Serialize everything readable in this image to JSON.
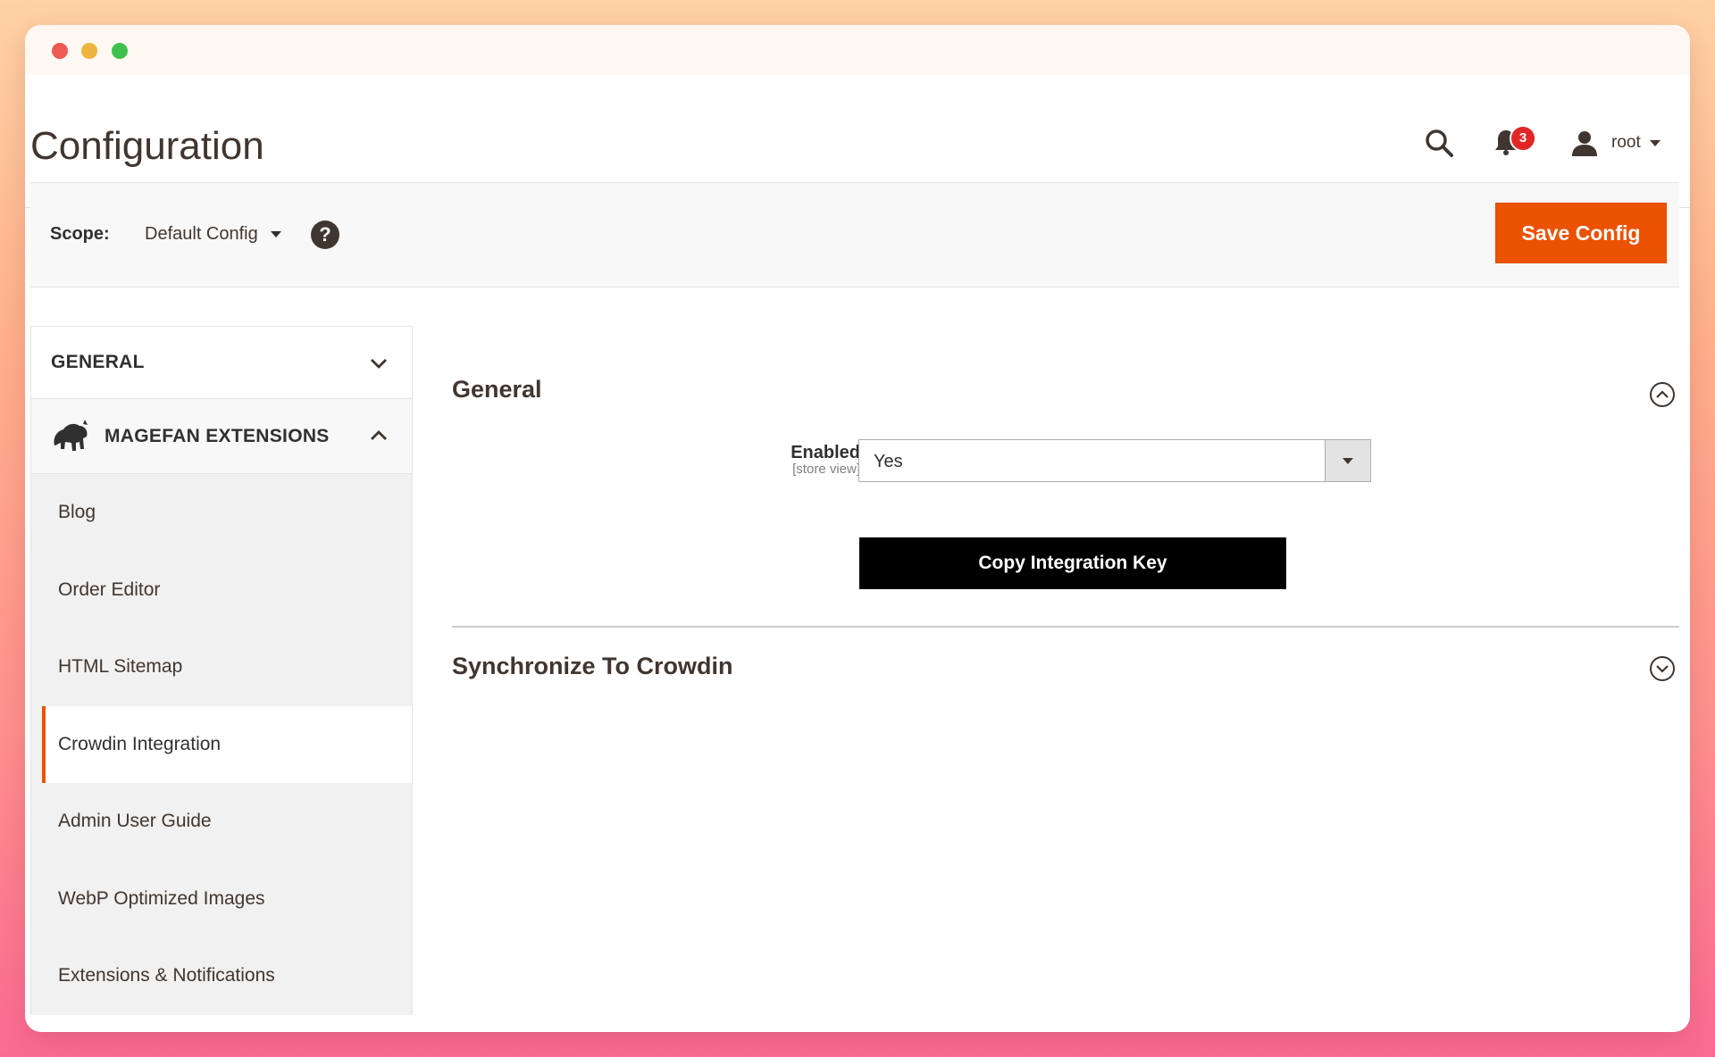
{
  "page": {
    "title": "Configuration"
  },
  "header": {
    "notification_count": "3",
    "user_name": "root"
  },
  "scope": {
    "label": "Scope:",
    "value": "Default Config",
    "help_glyph": "?"
  },
  "actions": {
    "save_label": "Save Config"
  },
  "sidebar": {
    "general_label": "GENERAL",
    "extensions_label": "MAGEFAN EXTENSIONS",
    "items": [
      {
        "label": "Blog"
      },
      {
        "label": "Order Editor"
      },
      {
        "label": "HTML Sitemap"
      },
      {
        "label": "Crowdin Integration",
        "active": true
      },
      {
        "label": "Admin User Guide"
      },
      {
        "label": "WebP Optimized Images"
      },
      {
        "label": "Extensions & Notifications"
      }
    ]
  },
  "sections": {
    "general": {
      "title": "General",
      "enabled_label": "Enabled",
      "enabled_scope": "[store view]",
      "enabled_value": "Yes",
      "copy_button": "Copy Integration Key"
    },
    "sync": {
      "title": "Synchronize To Crowdin"
    }
  },
  "colors": {
    "accent": "#eb5202",
    "badge": "#e22626",
    "text": "#41362f"
  }
}
